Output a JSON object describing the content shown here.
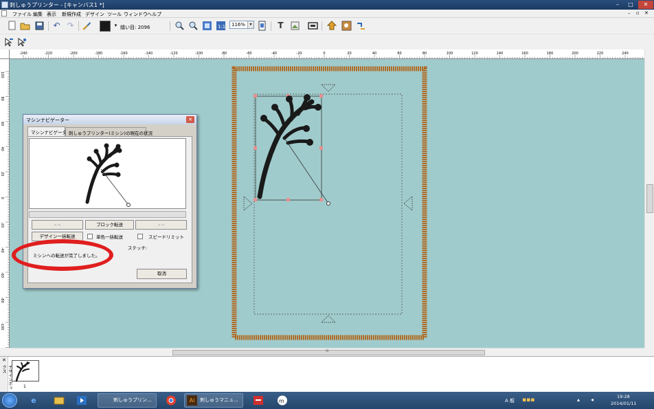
{
  "window": {
    "title": "刺しゅうプリンター - [キャンバス1 *]",
    "controls": {
      "minimize": "–",
      "maximize": "□",
      "close": "✕"
    }
  },
  "menu": {
    "items": [
      "ファイル",
      "編集",
      "表示",
      "新規作成",
      "デザイン",
      "ツール",
      "ウィンドウ",
      "ヘルプ"
    ],
    "mdi_controls": [
      "–",
      "▫",
      "✕"
    ]
  },
  "toolbar": {
    "stitch_count_label": "縫い目: 2096",
    "zoom_value": "116%",
    "text_tool": "T"
  },
  "ruler": {
    "h_labels": [
      "-240",
      "-220",
      "-200",
      "-180",
      "-160",
      "-140",
      "-120",
      "-100",
      "-80",
      "-60",
      "-40",
      "-20",
      "0",
      "20",
      "40",
      "60",
      "80",
      "100",
      "120",
      "140",
      "160",
      "180",
      "200",
      "220",
      "240"
    ],
    "v_labels": [
      "100",
      "80",
      "60",
      "40",
      "20",
      "0",
      "-20",
      "-40",
      "-60",
      "-80",
      "-100",
      "-120"
    ]
  },
  "hscroll_label": "III",
  "dialog": {
    "title": "マシンナビゲーター",
    "close": "✕",
    "tabs": [
      "マシンナビゲーター",
      "刺しゅうプリンター(ミシン)の現在の状況"
    ],
    "prev_button": "<<",
    "block_transfer_button": "ブロック転送",
    "next_button": ">>",
    "design_batch_button": "デザイン一括転送",
    "single_color_label": "単色一括転送",
    "speed_limit_label": "スピードリミット",
    "stitch_label": "ステッチ:",
    "status_message": "ミシンへの転送が完了しました。",
    "cancel_button": "取消"
  },
  "thumbnails": {
    "panel_label": "デザインボックス",
    "close": "✕",
    "items": [
      {
        "number": "1"
      }
    ]
  },
  "taskbar": {
    "tasks": [
      "刺しゅうプリン...",
      "刺しゅうマニュ..."
    ],
    "ai_label": "Ai",
    "tray_text": "A 般",
    "time": "19:28",
    "date": "2014/01/11"
  },
  "colors": {
    "canvas_bg": "#a0cbcc",
    "hoop_frame": "#b06a22",
    "thread": "#1a1a1a",
    "annotation": "#e01e1e",
    "titlebar": "#2a4e7c"
  }
}
